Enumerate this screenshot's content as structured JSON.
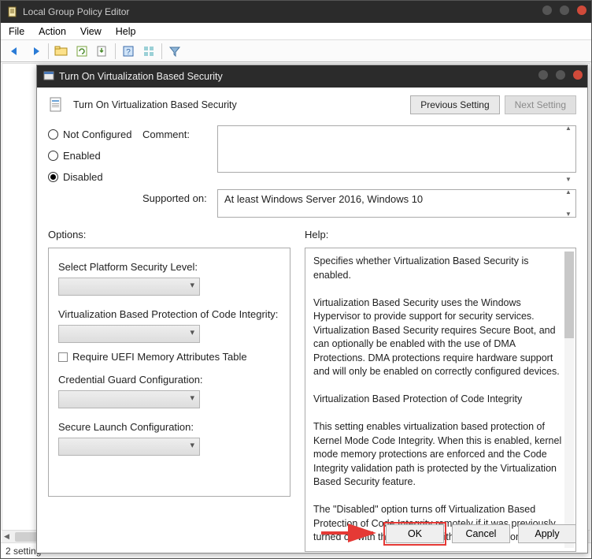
{
  "parent": {
    "title": "Local Group Policy Editor",
    "menus": [
      "File",
      "Action",
      "View",
      "Help"
    ],
    "status": "2 setting"
  },
  "dialog": {
    "title": "Turn On Virtualization Based Security",
    "header_title": "Turn On Virtualization Based Security",
    "prev_btn": "Previous Setting",
    "next_btn": "Next Setting",
    "radios": {
      "not_configured": "Not Configured",
      "enabled": "Enabled",
      "disabled": "Disabled"
    },
    "comment_label": "Comment:",
    "supported_label": "Supported on:",
    "supported_value": "At least Windows Server 2016, Windows 10",
    "options_label": "Options:",
    "help_label": "Help:",
    "options": {
      "platform_level": "Select Platform Security Level:",
      "vbprot": "Virtualization Based Protection of Code Integrity:",
      "uefi_check": "Require UEFI Memory Attributes Table",
      "credguard": "Credential Guard Configuration:",
      "secure_launch": "Secure Launch Configuration:"
    },
    "help": {
      "p1": "Specifies whether Virtualization Based Security is enabled.",
      "p2": "Virtualization Based Security uses the Windows Hypervisor to provide support for security services. Virtualization Based Security requires Secure Boot, and can optionally be enabled with the use of DMA Protections. DMA protections require hardware support and will only be enabled on correctly configured devices.",
      "p3": "Virtualization Based Protection of Code Integrity",
      "p4": "This setting enables virtualization based protection of Kernel Mode Code Integrity. When this is enabled, kernel mode memory protections are enforced and the Code Integrity validation path is protected by the Virtualization Based Security feature.",
      "p5": "The \"Disabled\" option turns off Virtualization Based Protection of Code Integrity remotely if it was previously turned on with the \"Enabled without lock\" option."
    },
    "buttons": {
      "ok": "OK",
      "cancel": "Cancel",
      "apply": "Apply"
    }
  }
}
